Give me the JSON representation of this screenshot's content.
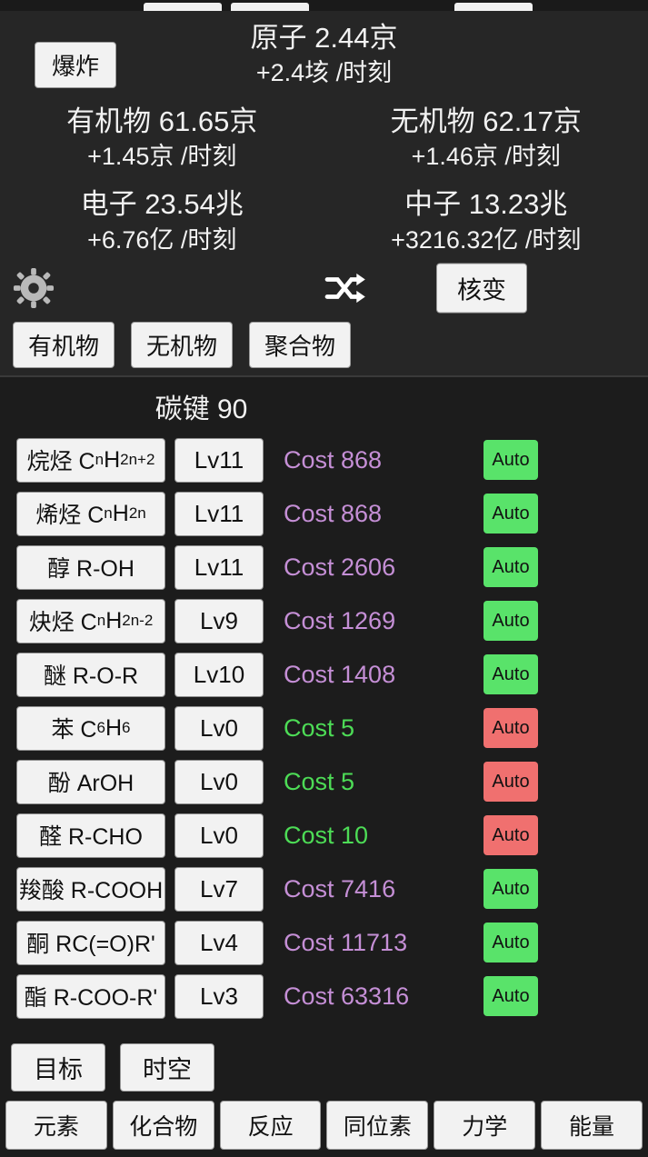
{
  "stats": {
    "atoms_label_value": "原子 2.44京",
    "atoms_rate": "+2.4垓 /时刻",
    "explode_button": "爆炸",
    "organic": {
      "value": "有机物 61.65京",
      "rate": "+1.45京 /时刻"
    },
    "inorganic": {
      "value": "无机物 62.17京",
      "rate": "+1.46京 /时刻"
    },
    "electron": {
      "value": "电子 23.54兆",
      "rate": "+6.76亿 /时刻"
    },
    "neutron": {
      "value": "中子 13.23兆",
      "rate": "+3216.32亿 /时刻"
    }
  },
  "actions": {
    "gear_icon": "gear-icon",
    "shuffle_icon": "shuffle-icon",
    "fusion_button": "核变"
  },
  "category_tabs": [
    {
      "label": "有机物",
      "selected": true
    },
    {
      "label": "无机物",
      "selected": false
    },
    {
      "label": "聚合物",
      "selected": false
    }
  ],
  "bond_title": "碳键 90",
  "list": [
    {
      "name": "烷烃 C",
      "sub1": "n",
      "mid": "H",
      "sub2": "2n+2",
      "tail": "",
      "level": "Lv11",
      "cost": "Cost 868",
      "cost_state": "expensive",
      "auto": "Auto",
      "auto_state": "on"
    },
    {
      "name": "烯烃 C",
      "sub1": "n",
      "mid": "H",
      "sub2": "2n",
      "tail": "",
      "level": "Lv11",
      "cost": "Cost 868",
      "cost_state": "expensive",
      "auto": "Auto",
      "auto_state": "on"
    },
    {
      "name": "醇 R-OH",
      "sub1": "",
      "mid": "",
      "sub2": "",
      "tail": "",
      "level": "Lv11",
      "cost": "Cost 2606",
      "cost_state": "expensive",
      "auto": "Auto",
      "auto_state": "on"
    },
    {
      "name": "炔烃 C",
      "sub1": "n",
      "mid": "H",
      "sub2": "2n-2",
      "tail": "",
      "level": "Lv9",
      "cost": "Cost 1269",
      "cost_state": "expensive",
      "auto": "Auto",
      "auto_state": "on"
    },
    {
      "name": "醚 R-O-R",
      "sub1": "",
      "mid": "",
      "sub2": "",
      "tail": "",
      "level": "Lv10",
      "cost": "Cost 1408",
      "cost_state": "expensive",
      "auto": "Auto",
      "auto_state": "on"
    },
    {
      "name": "苯 C",
      "sub1": "6",
      "mid": "H",
      "sub2": "6",
      "tail": "",
      "level": "Lv0",
      "cost": "Cost 5",
      "cost_state": "affordable",
      "auto": "Auto",
      "auto_state": "off"
    },
    {
      "name": "酚 ArOH",
      "sub1": "",
      "mid": "",
      "sub2": "",
      "tail": "",
      "level": "Lv0",
      "cost": "Cost 5",
      "cost_state": "affordable",
      "auto": "Auto",
      "auto_state": "off"
    },
    {
      "name": "醛 R-CHO",
      "sub1": "",
      "mid": "",
      "sub2": "",
      "tail": "",
      "level": "Lv0",
      "cost": "Cost 10",
      "cost_state": "affordable",
      "auto": "Auto",
      "auto_state": "off"
    },
    {
      "name": "羧酸 R-COOH",
      "sub1": "",
      "mid": "",
      "sub2": "",
      "tail": "",
      "level": "Lv7",
      "cost": "Cost 7416",
      "cost_state": "expensive",
      "auto": "Auto",
      "auto_state": "on"
    },
    {
      "name": "酮 RC(=O)R'",
      "sub1": "",
      "mid": "",
      "sub2": "",
      "tail": "",
      "level": "Lv4",
      "cost": "Cost 11713",
      "cost_state": "expensive",
      "auto": "Auto",
      "auto_state": "on"
    },
    {
      "name": "酯 R-COO-R'",
      "sub1": "",
      "mid": "",
      "sub2": "",
      "tail": "",
      "level": "Lv3",
      "cost": "Cost 63316",
      "cost_state": "expensive",
      "auto": "Auto",
      "auto_state": "on"
    }
  ],
  "bottom_mid": [
    {
      "label": "目标"
    },
    {
      "label": "时空"
    }
  ],
  "bottom_nav": [
    {
      "label": "元素"
    },
    {
      "label": "化合物"
    },
    {
      "label": "反应"
    },
    {
      "label": "同位素"
    },
    {
      "label": "力学"
    },
    {
      "label": "能量"
    }
  ],
  "colors": {
    "affordable": "#4ddc56",
    "expensive": "#c58fd6",
    "auto_on": "#59e36a",
    "auto_off": "#f0706f",
    "panel": "#262626",
    "background": "#1c1c1c"
  }
}
